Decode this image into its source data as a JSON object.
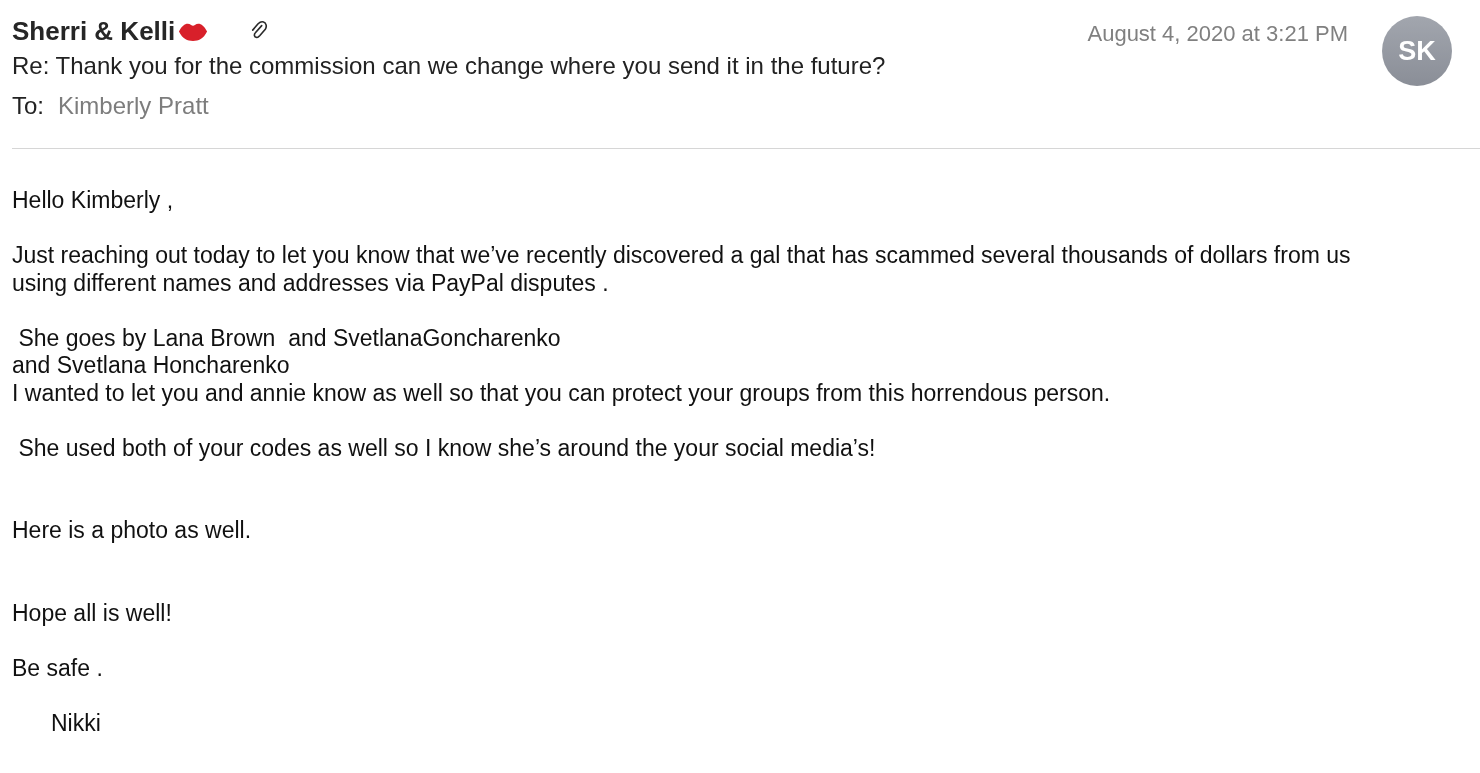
{
  "header": {
    "sender": "Sherri & Kelli",
    "has_attachment": true,
    "date": "August 4, 2020 at 3:21 PM",
    "avatar_initials": "SK",
    "subject": "Re: Thank you for the commission can we change where you send it in the future?",
    "to_label": "To:",
    "to": "Kimberly Pratt"
  },
  "body": [
    {
      "kind": "first",
      "lines": [
        "Hello Kimberly ,"
      ]
    },
    {
      "kind": "spaced",
      "lines": [
        "Just reaching out today to let you know that we’ve recently discovered a gal that has scammed several thousands of dollars from us",
        "using different names and addresses via PayPal disputes ."
      ]
    },
    {
      "kind": "spaced",
      "lines": [
        " She goes by Lana Brown  and SvetlanaGoncharenko",
        "and Svetlana Honcharenko",
        "I wanted to let you and annie know as well so that you can protect your groups from this horrendous person."
      ]
    },
    {
      "kind": "spaced",
      "lines": [
        " She used both of your codes as well so I know she’s around the your social media’s!"
      ]
    },
    {
      "kind": "wide",
      "lines": [
        "Here is a photo as well."
      ]
    },
    {
      "kind": "wide",
      "lines": [
        "Hope all is well!"
      ]
    },
    {
      "kind": "spaced",
      "lines": [
        "Be safe ."
      ]
    },
    {
      "kind": "signature",
      "lines": [
        "Nikki"
      ]
    }
  ]
}
